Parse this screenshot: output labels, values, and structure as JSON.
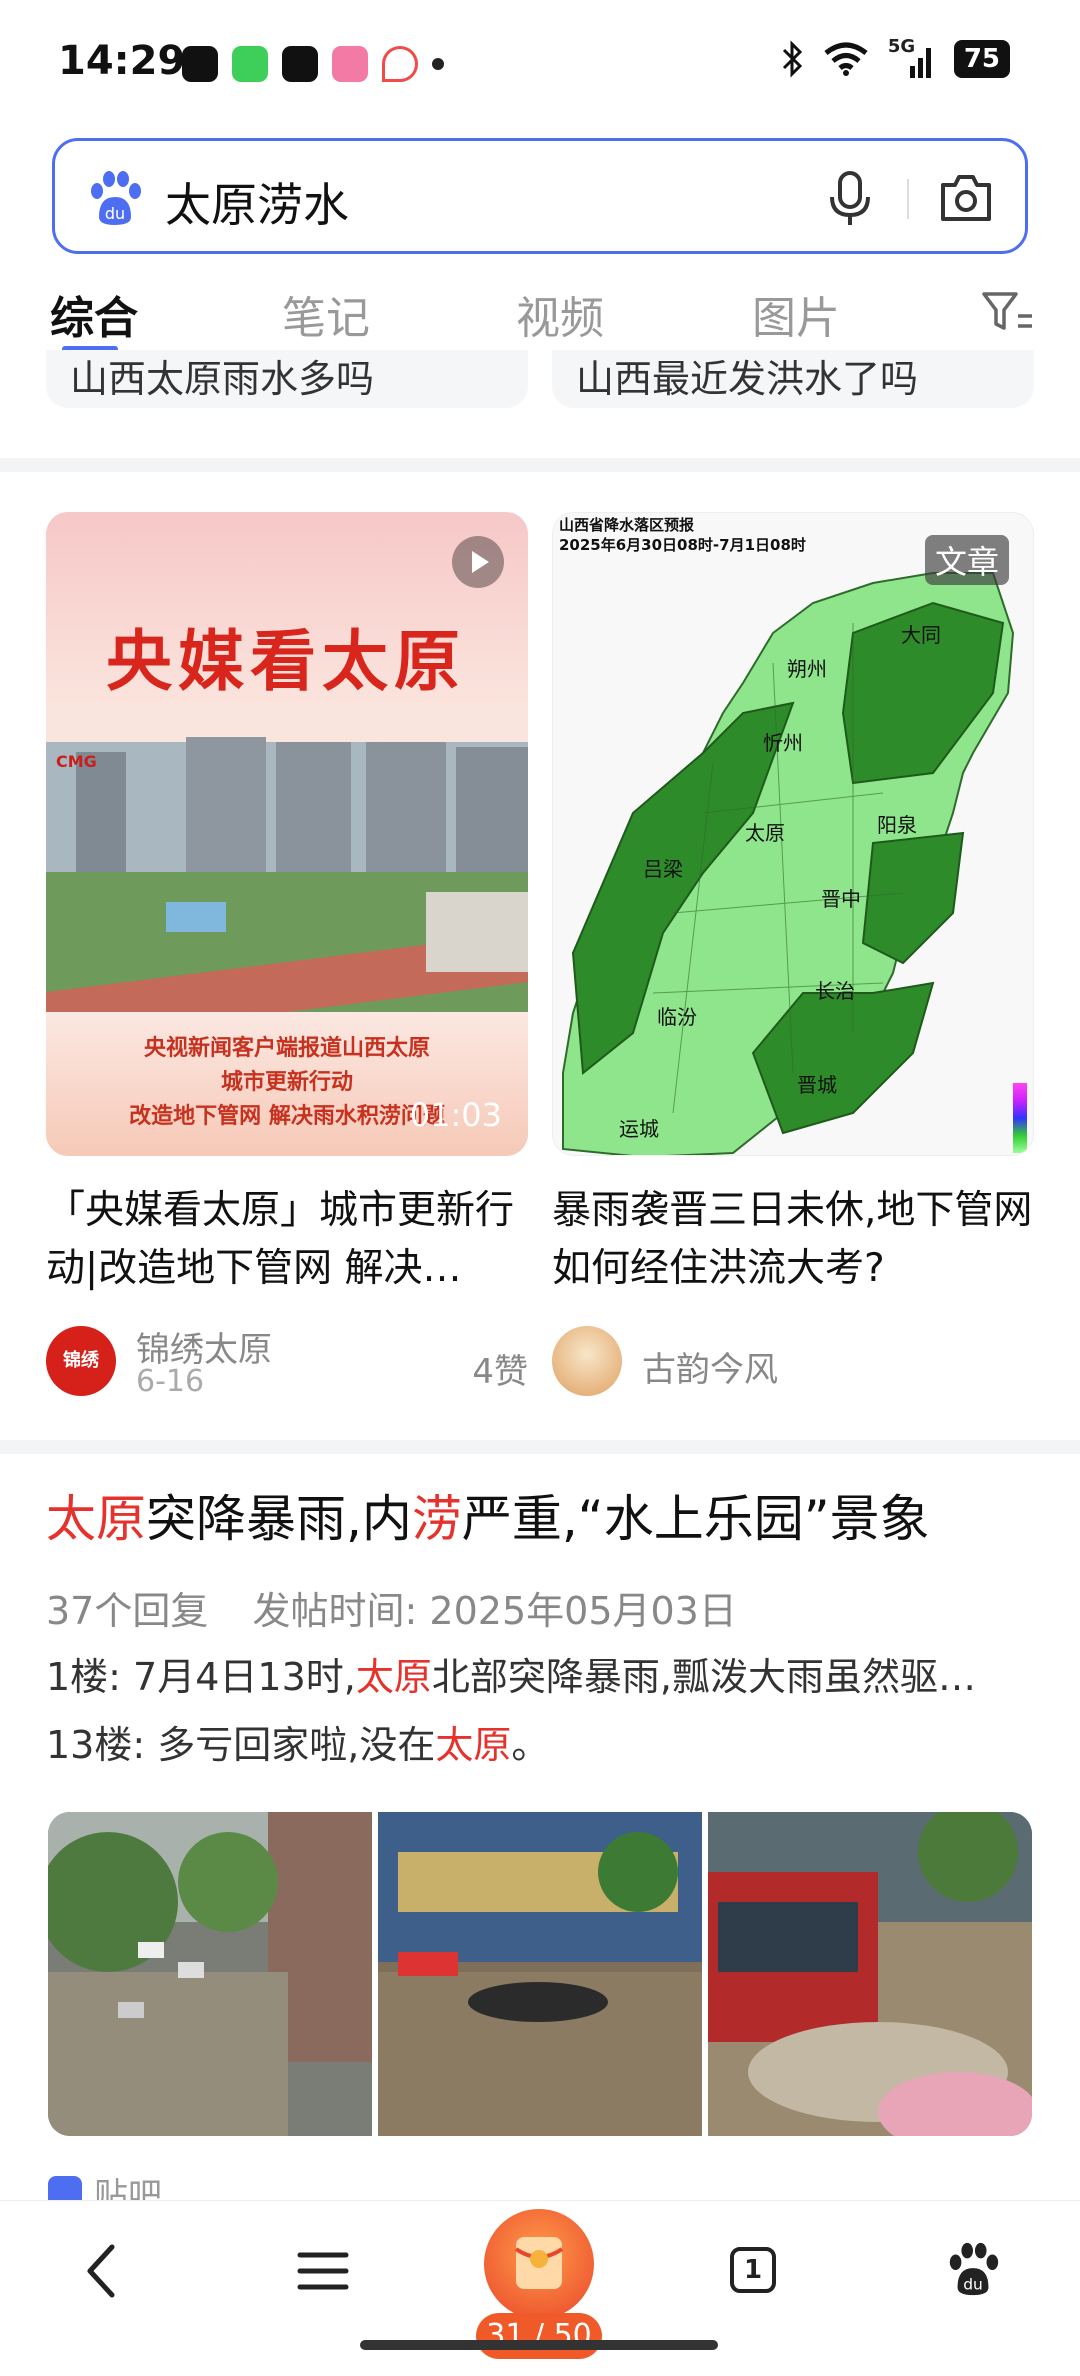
{
  "status_bar": {
    "time": "14:29",
    "network": "5G",
    "battery": "75"
  },
  "search": {
    "query": "太原涝水"
  },
  "tabs": [
    {
      "label": "综合",
      "active": true
    },
    {
      "label": "笔记",
      "active": false
    },
    {
      "label": "视频",
      "active": false
    },
    {
      "label": "图片",
      "active": false
    }
  ],
  "chips": [
    "山西太原雨水多吗",
    "山西最近发洪水了吗"
  ],
  "cards": [
    {
      "thumb_title": "央媒看太原",
      "thumb_caption_1": "央视新闻客户端报道山西太原",
      "thumb_caption_2": "城市更新行动",
      "thumb_caption_3": "改造地下管网 解决雨水积涝问题",
      "duration": "01:03",
      "title": "「央媒看太原」城市更新行动|改造地下管网 解决…",
      "author": "锦绣太原",
      "date": "6-16",
      "likes": "4赞",
      "avatar_text": "锦绣"
    },
    {
      "badge": "文章",
      "map_title_1": "山西省降水落区预报",
      "map_title_2": "2025年6月30日08时-7月1日08时",
      "map_labels": [
        "大同",
        "朔州",
        "忻州",
        "太原",
        "阳泉",
        "吕梁",
        "晋中",
        "长治",
        "临汾",
        "晋城",
        "运城"
      ],
      "title": "暴雨袭晋三日未休,地下管网如何经住洪流大考?",
      "author": "古韵今风"
    }
  ],
  "post": {
    "title_parts": [
      {
        "text": "太原",
        "hl": true
      },
      {
        "text": "突降暴雨,内",
        "hl": false
      },
      {
        "text": "涝",
        "hl": true
      },
      {
        "text": "严重,“水上乐园”景象",
        "hl": false
      }
    ],
    "replies": "37个回复",
    "posted": "发帖时间: 2025年05月03日",
    "line1_pre": "1楼: 7月4日13时,",
    "line1_hl": "太原",
    "line1_post": "北部突降暴雨,瓢泼大雨虽然驱…",
    "line2_pre": "13楼: 多亏回家啦,没在",
    "line2_hl": "太原",
    "line2_post": "。",
    "source": "贴吧"
  },
  "bottom_nav": {
    "tab_count": "1",
    "progress": "31 / 50"
  },
  "colors": {
    "accent": "#4e6ef2",
    "highlight": "#e6322c",
    "progress": "#f05a28"
  }
}
